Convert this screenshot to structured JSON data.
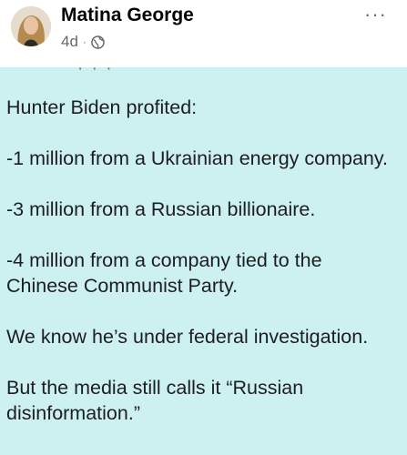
{
  "post": {
    "author": "Matina George",
    "time": "4d",
    "separator": "·",
    "privacy_icon": "globe-icon",
    "more_icon": "more-options-icon",
    "more_label": "···"
  },
  "content": {
    "cut_text": "· · ·",
    "paragraphs": [
      {
        "lines": [
          "Hunter Biden profited:"
        ]
      },
      {
        "lines": [
          "-1 million from a Ukrainian energy company."
        ]
      },
      {
        "lines": [
          "-3 million from a Russian billionaire."
        ]
      },
      {
        "lines": [
          "-4 million from a company tied to the",
          "Chinese Communist Party."
        ]
      },
      {
        "lines": [
          "We know he’s under federal investigation."
        ]
      },
      {
        "lines": [
          "But the media still calls it “Russian",
          "disinformation.”"
        ]
      }
    ]
  },
  "colors": {
    "card_background": "#cdf0f1",
    "text": "#1c1e21",
    "meta": "#65676b"
  }
}
